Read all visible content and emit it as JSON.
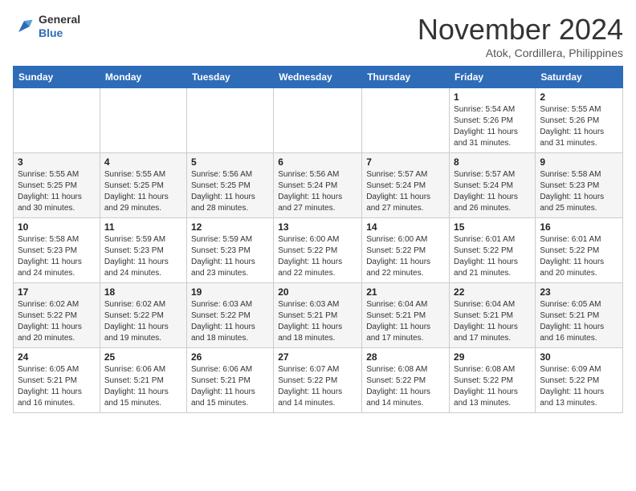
{
  "header": {
    "logo_general": "General",
    "logo_blue": "Blue",
    "month": "November 2024",
    "location": "Atok, Cordillera, Philippines"
  },
  "days_of_week": [
    "Sunday",
    "Monday",
    "Tuesday",
    "Wednesday",
    "Thursday",
    "Friday",
    "Saturday"
  ],
  "weeks": [
    [
      {
        "day": "",
        "info": ""
      },
      {
        "day": "",
        "info": ""
      },
      {
        "day": "",
        "info": ""
      },
      {
        "day": "",
        "info": ""
      },
      {
        "day": "",
        "info": ""
      },
      {
        "day": "1",
        "info": "Sunrise: 5:54 AM\nSunset: 5:26 PM\nDaylight: 11 hours and 31 minutes."
      },
      {
        "day": "2",
        "info": "Sunrise: 5:55 AM\nSunset: 5:26 PM\nDaylight: 11 hours and 31 minutes."
      }
    ],
    [
      {
        "day": "3",
        "info": "Sunrise: 5:55 AM\nSunset: 5:25 PM\nDaylight: 11 hours and 30 minutes."
      },
      {
        "day": "4",
        "info": "Sunrise: 5:55 AM\nSunset: 5:25 PM\nDaylight: 11 hours and 29 minutes."
      },
      {
        "day": "5",
        "info": "Sunrise: 5:56 AM\nSunset: 5:25 PM\nDaylight: 11 hours and 28 minutes."
      },
      {
        "day": "6",
        "info": "Sunrise: 5:56 AM\nSunset: 5:24 PM\nDaylight: 11 hours and 27 minutes."
      },
      {
        "day": "7",
        "info": "Sunrise: 5:57 AM\nSunset: 5:24 PM\nDaylight: 11 hours and 27 minutes."
      },
      {
        "day": "8",
        "info": "Sunrise: 5:57 AM\nSunset: 5:24 PM\nDaylight: 11 hours and 26 minutes."
      },
      {
        "day": "9",
        "info": "Sunrise: 5:58 AM\nSunset: 5:23 PM\nDaylight: 11 hours and 25 minutes."
      }
    ],
    [
      {
        "day": "10",
        "info": "Sunrise: 5:58 AM\nSunset: 5:23 PM\nDaylight: 11 hours and 24 minutes."
      },
      {
        "day": "11",
        "info": "Sunrise: 5:59 AM\nSunset: 5:23 PM\nDaylight: 11 hours and 24 minutes."
      },
      {
        "day": "12",
        "info": "Sunrise: 5:59 AM\nSunset: 5:23 PM\nDaylight: 11 hours and 23 minutes."
      },
      {
        "day": "13",
        "info": "Sunrise: 6:00 AM\nSunset: 5:22 PM\nDaylight: 11 hours and 22 minutes."
      },
      {
        "day": "14",
        "info": "Sunrise: 6:00 AM\nSunset: 5:22 PM\nDaylight: 11 hours and 22 minutes."
      },
      {
        "day": "15",
        "info": "Sunrise: 6:01 AM\nSunset: 5:22 PM\nDaylight: 11 hours and 21 minutes."
      },
      {
        "day": "16",
        "info": "Sunrise: 6:01 AM\nSunset: 5:22 PM\nDaylight: 11 hours and 20 minutes."
      }
    ],
    [
      {
        "day": "17",
        "info": "Sunrise: 6:02 AM\nSunset: 5:22 PM\nDaylight: 11 hours and 20 minutes."
      },
      {
        "day": "18",
        "info": "Sunrise: 6:02 AM\nSunset: 5:22 PM\nDaylight: 11 hours and 19 minutes."
      },
      {
        "day": "19",
        "info": "Sunrise: 6:03 AM\nSunset: 5:22 PM\nDaylight: 11 hours and 18 minutes."
      },
      {
        "day": "20",
        "info": "Sunrise: 6:03 AM\nSunset: 5:21 PM\nDaylight: 11 hours and 18 minutes."
      },
      {
        "day": "21",
        "info": "Sunrise: 6:04 AM\nSunset: 5:21 PM\nDaylight: 11 hours and 17 minutes."
      },
      {
        "day": "22",
        "info": "Sunrise: 6:04 AM\nSunset: 5:21 PM\nDaylight: 11 hours and 17 minutes."
      },
      {
        "day": "23",
        "info": "Sunrise: 6:05 AM\nSunset: 5:21 PM\nDaylight: 11 hours and 16 minutes."
      }
    ],
    [
      {
        "day": "24",
        "info": "Sunrise: 6:05 AM\nSunset: 5:21 PM\nDaylight: 11 hours and 16 minutes."
      },
      {
        "day": "25",
        "info": "Sunrise: 6:06 AM\nSunset: 5:21 PM\nDaylight: 11 hours and 15 minutes."
      },
      {
        "day": "26",
        "info": "Sunrise: 6:06 AM\nSunset: 5:21 PM\nDaylight: 11 hours and 15 minutes."
      },
      {
        "day": "27",
        "info": "Sunrise: 6:07 AM\nSunset: 5:22 PM\nDaylight: 11 hours and 14 minutes."
      },
      {
        "day": "28",
        "info": "Sunrise: 6:08 AM\nSunset: 5:22 PM\nDaylight: 11 hours and 14 minutes."
      },
      {
        "day": "29",
        "info": "Sunrise: 6:08 AM\nSunset: 5:22 PM\nDaylight: 11 hours and 13 minutes."
      },
      {
        "day": "30",
        "info": "Sunrise: 6:09 AM\nSunset: 5:22 PM\nDaylight: 11 hours and 13 minutes."
      }
    ]
  ]
}
